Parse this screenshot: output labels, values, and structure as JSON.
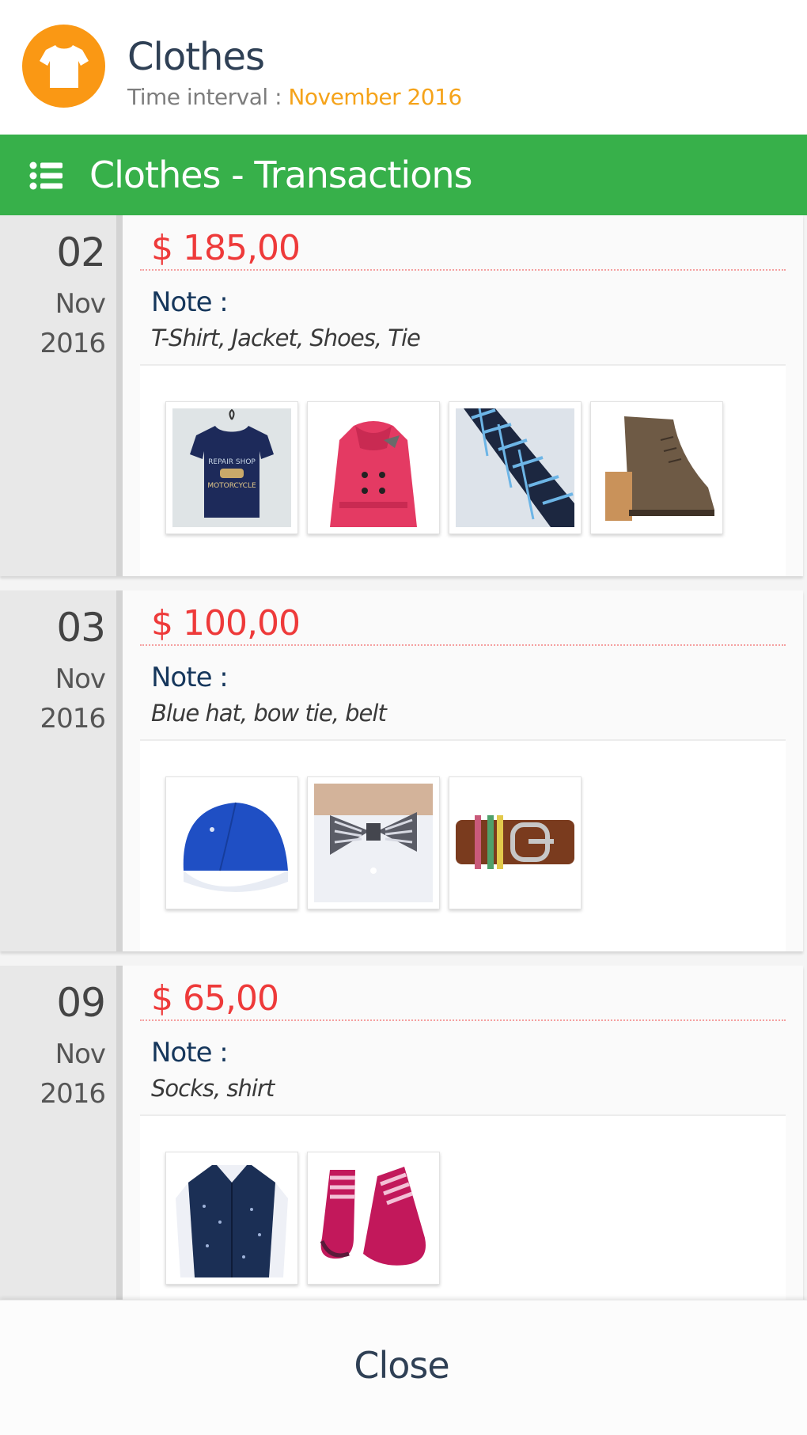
{
  "category": {
    "title": "Clothes",
    "interval_label": "Time interval :",
    "interval_value": "November 2016",
    "icon": "tshirt-icon",
    "accent_color": "#fa9814"
  },
  "panel": {
    "title": "Clothes - Transactions",
    "icon": "list-icon",
    "color": "#37b04a"
  },
  "transactions": [
    {
      "day": "02",
      "month": "Nov",
      "year": "2016",
      "amount": "$ 185,00",
      "note_label": "Note :",
      "note": "T-Shirt, Jacket, Shoes, Tie",
      "photos": [
        "tshirt-photo",
        "jacket-photo",
        "tie-photo",
        "shoe-photo"
      ]
    },
    {
      "day": "03",
      "month": "Nov",
      "year": "2016",
      "amount": "$ 100,00",
      "note_label": "Note :",
      "note": "Blue hat, bow tie, belt",
      "photos": [
        "cap-photo",
        "bowtie-photo",
        "belt-photo"
      ]
    },
    {
      "day": "09",
      "month": "Nov",
      "year": "2016",
      "amount": "$ 65,00",
      "note_label": "Note :",
      "note": "Socks, shirt",
      "photos": [
        "shirt-photo",
        "socks-photo"
      ]
    }
  ],
  "footer": {
    "close_label": "Close"
  }
}
